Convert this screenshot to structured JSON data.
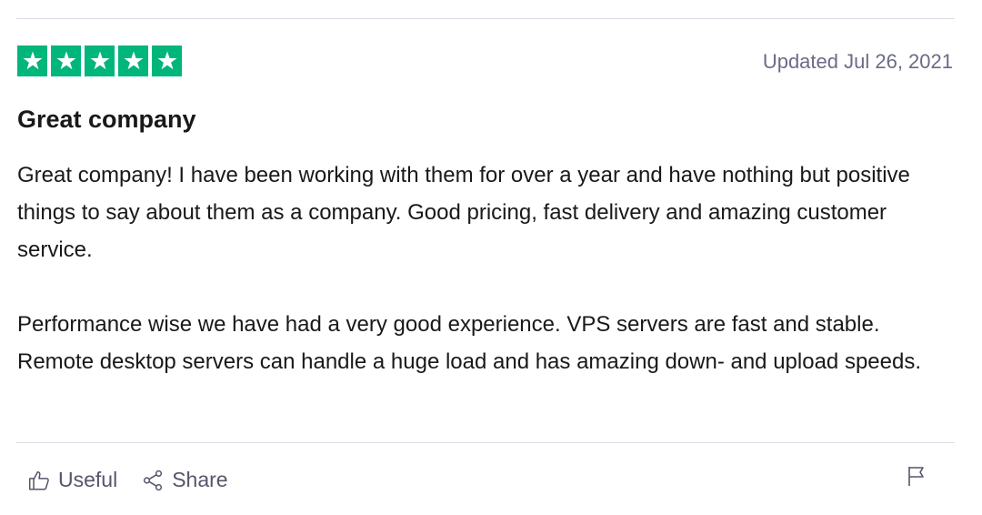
{
  "review": {
    "rating": 5,
    "rating_max": 5,
    "star_color": "#00b67a",
    "date": "Updated Jul 26, 2021",
    "title": "Great company",
    "paragraphs": [
      "Great company! I have been working with them for over a year and have nothing but positive things to say about them as a company. Good pricing, fast delivery and amazing customer service.",
      "Performance wise we have had a very good experience. VPS servers are fast and stable. Remote desktop servers can handle a huge load and has amazing down- and upload speeds."
    ]
  },
  "actions": {
    "useful_label": "Useful",
    "useful_icon": "thumbs-up-icon",
    "share_label": "Share",
    "share_icon": "share-icon",
    "flag_icon": "flag-icon"
  }
}
